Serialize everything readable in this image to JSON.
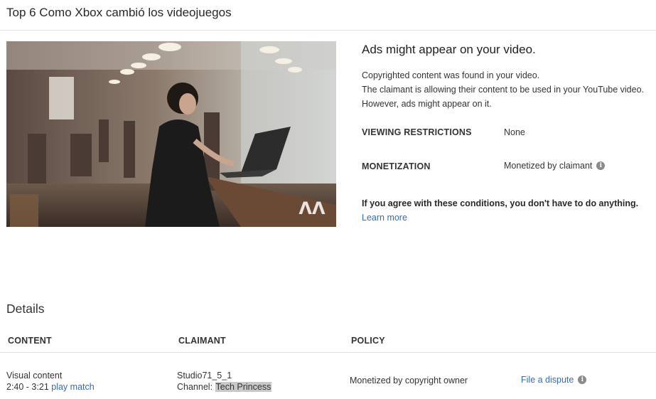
{
  "header": {
    "title": "Top 6 Como Xbox cambió los videojuegos"
  },
  "thumbnail": {
    "watermark": "ΛΛ"
  },
  "info": {
    "heading": "Ads might appear on your video.",
    "description": [
      "Copyrighted content was found in your video.",
      "The claimant is allowing their content to be used in your YouTube video.",
      "However, ads might appear on it."
    ],
    "viewing_restrictions": {
      "label": "VIEWING RESTRICTIONS",
      "value": "None"
    },
    "monetization": {
      "label": "MONETIZATION",
      "value": "Monetized by claimant",
      "icon": "info-icon"
    },
    "agree_text": "If you agree with these conditions, you don't have to do anything.",
    "learn_more": "Learn more"
  },
  "details": {
    "heading": "Details",
    "columns": {
      "content": "CONTENT",
      "claimant": "CLAIMANT",
      "policy": "POLICY"
    },
    "row": {
      "content_type": "Visual content",
      "time_range": "2:40 - 3:21",
      "play_match": "play match",
      "claimant_name": "Studio71_5_1",
      "channel_prefix": "Channel:",
      "channel_name": "Tech Princess",
      "policy": "Monetized by copyright owner",
      "dispute": "File a dispute",
      "dispute_icon": "info-icon"
    }
  }
}
